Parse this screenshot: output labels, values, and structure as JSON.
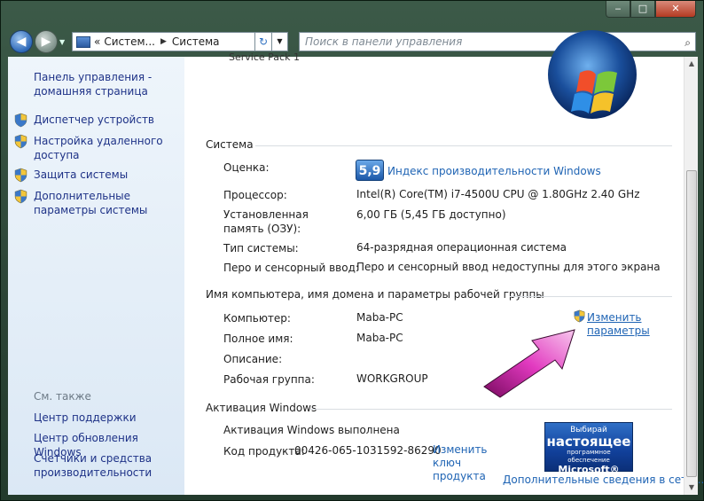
{
  "window": {
    "min_glyph": "‒",
    "max_glyph": "□",
    "close_glyph": "✕"
  },
  "nav": {
    "back_glyph": "◀",
    "forward_glyph": "▶",
    "dropdown_glyph": "▼",
    "breadcrumb_prefix": "«",
    "breadcrumb_1": "Систем...",
    "breadcrumb_sep": "▶",
    "breadcrumb_2": "Система",
    "refresh_glyph": "↻",
    "search_placeholder": "Поиск в панели управления",
    "search_glyph": "⌕"
  },
  "sidebar": {
    "home": "Панель управления - домашняя страница",
    "tasks": [
      {
        "label": "Диспетчер устройств"
      },
      {
        "label": "Настройка удаленного доступа"
      },
      {
        "label": "Защита системы"
      },
      {
        "label": "Дополнительные параметры системы"
      }
    ],
    "see_also": "См. также",
    "links": [
      {
        "label": "Центр поддержки"
      },
      {
        "label": "Центр обновления Windows"
      },
      {
        "label": "Счетчики и средства производительности"
      }
    ]
  },
  "main": {
    "service_pack": "Service Pack 1",
    "system": {
      "header": "Система",
      "rating_label": "Оценка:",
      "rating_score": "5,9",
      "rating_link": "Индекс производительности Windows",
      "cpu_label": "Процессор:",
      "cpu_value": "Intel(R) Core(TM) i7-4500U CPU @ 1.80GHz   2.40 GHz",
      "ram_label": "Установленная память (ОЗУ):",
      "ram_value": "6,00 ГБ (5,45 ГБ доступно)",
      "type_label": "Тип системы:",
      "type_value": "64-разрядная операционная система",
      "pen_label": "Перо и сенсорный ввод:",
      "pen_value": "Перо и сенсорный ввод недоступны для этого экрана"
    },
    "computer": {
      "header": "Имя компьютера, имя домена и параметры рабочей группы",
      "name_label": "Компьютер:",
      "name_value": "Maba-PC",
      "full_label": "Полное имя:",
      "full_value": "Maba-PC",
      "desc_label": "Описание:",
      "desc_value": "",
      "wg_label": "Рабочая группа:",
      "wg_value": "WORKGROUP",
      "change_link": "Изменить параметры"
    },
    "activation": {
      "header": "Активация Windows",
      "status": "Активация Windows выполнена",
      "key_label": "Код продукта:",
      "key_value": "00426-065-1031592-86290",
      "change_key_link": "Изменить ключ продукта",
      "more_link": "Дополнительные сведения в сети...",
      "badge_l1": "Выбирай",
      "badge_l2": "настоящее",
      "badge_l3": "программное обеспечение",
      "badge_l4": "Microsoft®"
    }
  },
  "scrollbar": {
    "up_glyph": "▲",
    "down_glyph": "▼"
  },
  "colors": {
    "link": "#1f64b4",
    "sidebar_link": "#1e3287",
    "accent_arrow": "#c81ea0"
  }
}
